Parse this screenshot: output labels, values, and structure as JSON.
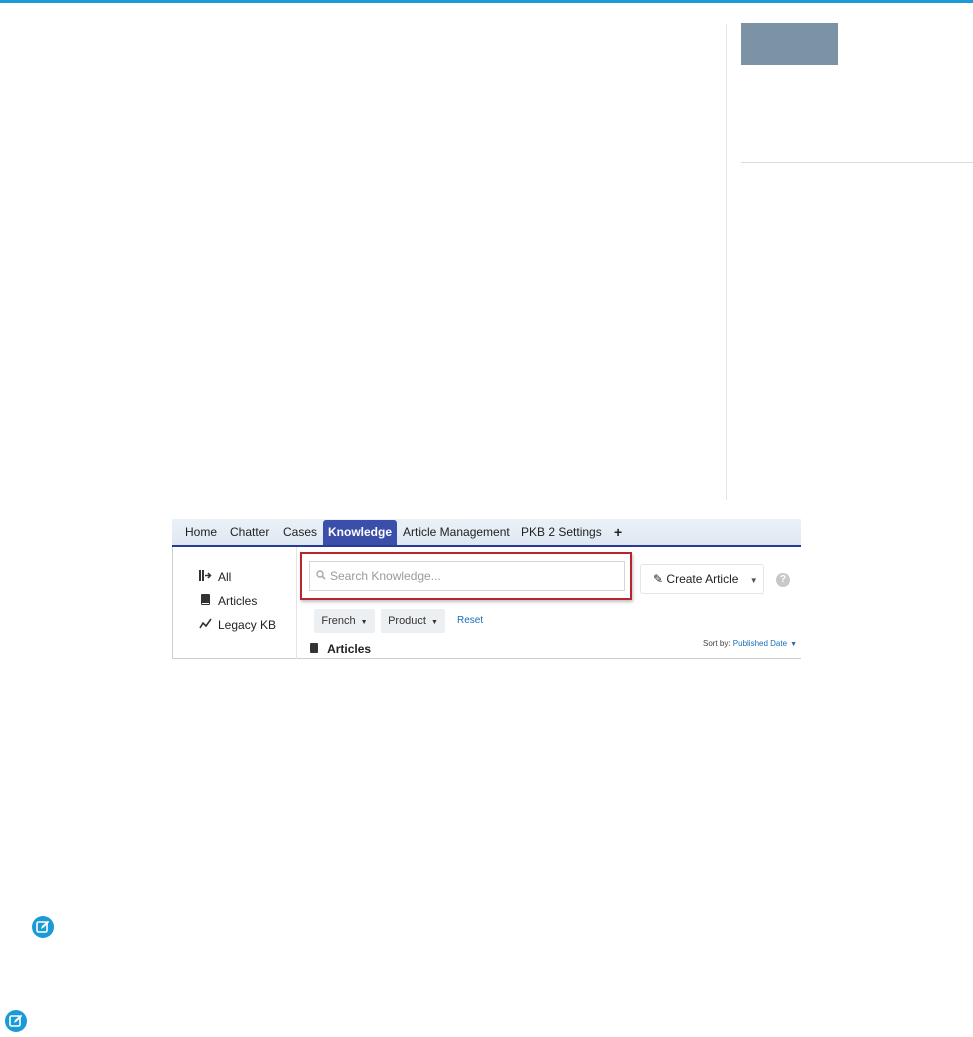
{
  "colors": {
    "accent": "#1a9bd7",
    "active_tab": "#3b4faa",
    "highlight_border": "#b3282d",
    "side_block": "#7b93a5"
  },
  "tabs": [
    {
      "label": "Home"
    },
    {
      "label": "Chatter"
    },
    {
      "label": "Cases"
    },
    {
      "label": "Knowledge",
      "active": true
    },
    {
      "label": "Article Management"
    },
    {
      "label": "PKB 2 Settings"
    },
    {
      "label": "+"
    }
  ],
  "sidebar": {
    "items": [
      {
        "label": "All",
        "icon": "all-articles-icon"
      },
      {
        "label": "Articles",
        "icon": "book-icon"
      },
      {
        "label": "Legacy KB",
        "icon": "trend-icon"
      }
    ]
  },
  "search": {
    "placeholder": "Search Knowledge...",
    "value": ""
  },
  "create_article": {
    "label": "Create Article"
  },
  "help": {
    "label": "?"
  },
  "filters": [
    {
      "label": "French"
    },
    {
      "label": "Product"
    }
  ],
  "reset": {
    "label": "Reset"
  },
  "list": {
    "title": "Articles"
  },
  "sort": {
    "label": "Sort by:",
    "value": "Published Date"
  }
}
